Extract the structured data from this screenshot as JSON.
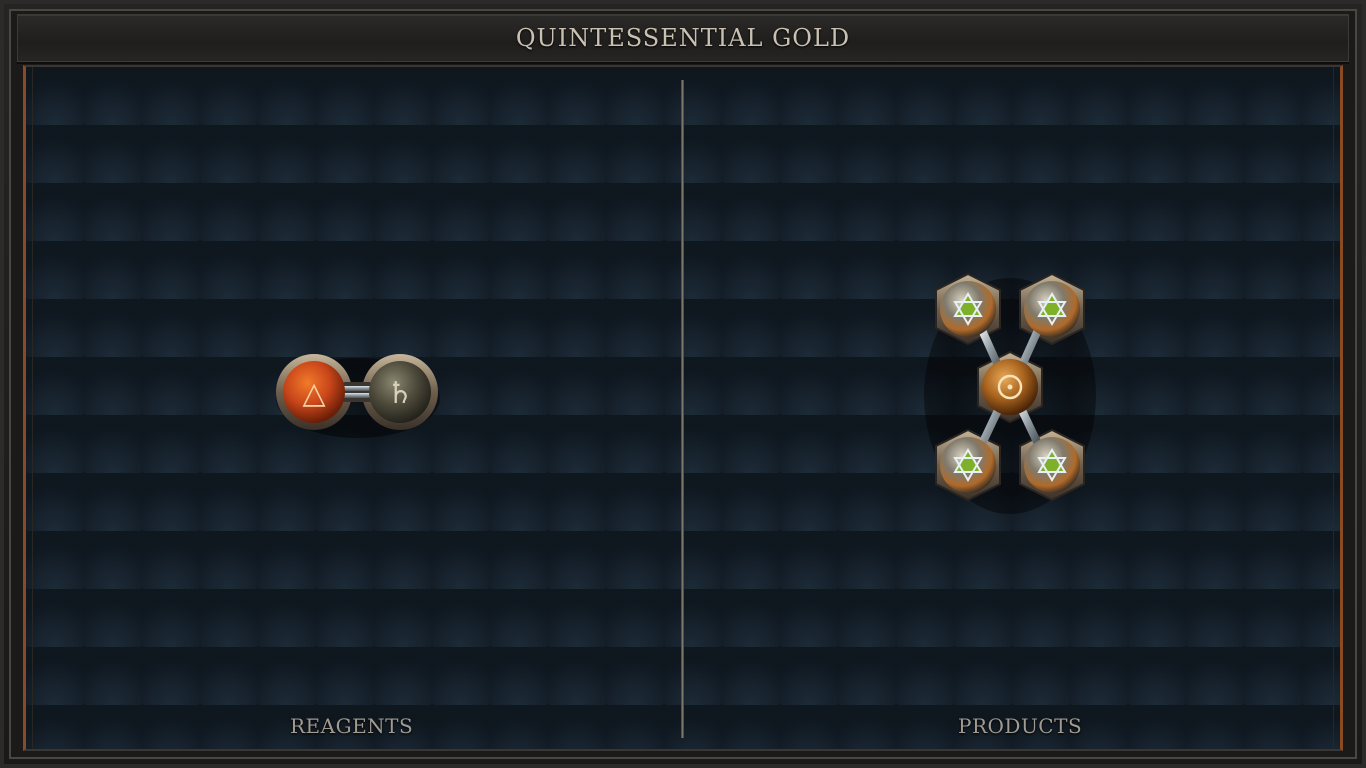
{
  "title": "QUINTESSENTIAL GOLD",
  "panels": {
    "left_label": "REAGENTS",
    "right_label": "PRODUCTS"
  },
  "reagents": {
    "atoms": [
      {
        "element": "fire",
        "symbol": "△",
        "color": "#c9461a"
      },
      {
        "element": "lead",
        "symbol": "♄",
        "color": "#4e4b3c"
      }
    ],
    "bonds": 1
  },
  "products": {
    "atoms": [
      {
        "element": "gold",
        "symbol": "☉",
        "color": "#a8631e"
      },
      {
        "element": "quintessence",
        "symbol": "✡",
        "color": "#6e8f2a"
      },
      {
        "element": "quintessence",
        "symbol": "✡",
        "color": "#6e8f2a"
      },
      {
        "element": "quintessence",
        "symbol": "✡",
        "color": "#6e8f2a"
      },
      {
        "element": "quintessence",
        "symbol": "✡",
        "color": "#6e8f2a"
      }
    ],
    "bonds": 4
  },
  "colors": {
    "accent_copper": "#8a4a22",
    "frame": "#2c2b29",
    "board": "#121c25",
    "label_text": "#a09a90"
  }
}
